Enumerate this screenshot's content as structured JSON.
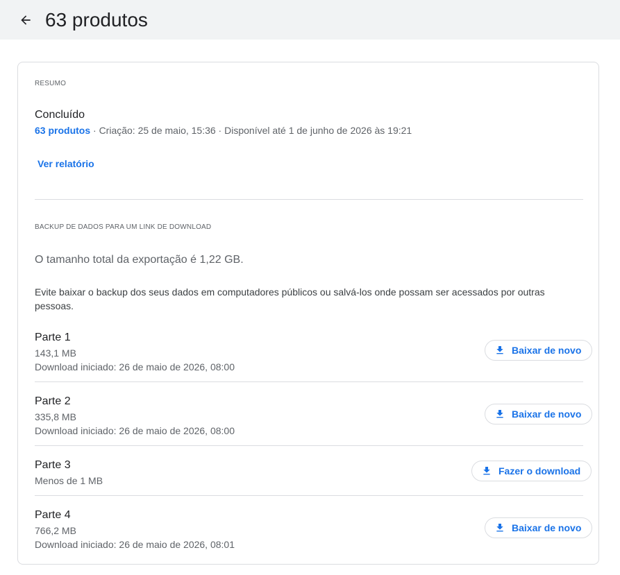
{
  "header": {
    "title": "63 produtos"
  },
  "summary": {
    "section_label": "RESUMO",
    "status": "Concluído",
    "products_link": "63 produtos",
    "meta_text": " · Criação: 25 de maio, 15:36 · Disponível até 1 de junho de 2026 às 19:21",
    "report_link": "Ver relatório"
  },
  "backup": {
    "section_label": "BACKUP DE DADOS PARA UM LINK DE DOWNLOAD",
    "total_size": "O tamanho total da exportação é 1,22 GB.",
    "warning": "Evite baixar o backup dos seus dados em computadores públicos ou salvá-los onde possam ser acessados por outras pessoas."
  },
  "parts": [
    {
      "title": "Parte 1",
      "size": "143,1 MB",
      "download_info": "Download iniciado: 26 de maio de 2026, 08:00",
      "button_label": "Baixar de novo"
    },
    {
      "title": "Parte 2",
      "size": "335,8 MB",
      "download_info": "Download iniciado: 26 de maio de 2026, 08:00",
      "button_label": "Baixar de novo"
    },
    {
      "title": "Parte 3",
      "size": "Menos de 1 MB",
      "download_info": "",
      "button_label": "Fazer o download"
    },
    {
      "title": "Parte 4",
      "size": "766,2 MB",
      "download_info": "Download iniciado: 26 de maio de 2026, 08:01",
      "button_label": "Baixar de novo"
    }
  ],
  "icons": {
    "back": "arrow-back-icon",
    "download": "download-icon"
  },
  "colors": {
    "accent": "#1a73e8",
    "header_bg": "#f1f3f4",
    "divider": "#dadce0"
  }
}
